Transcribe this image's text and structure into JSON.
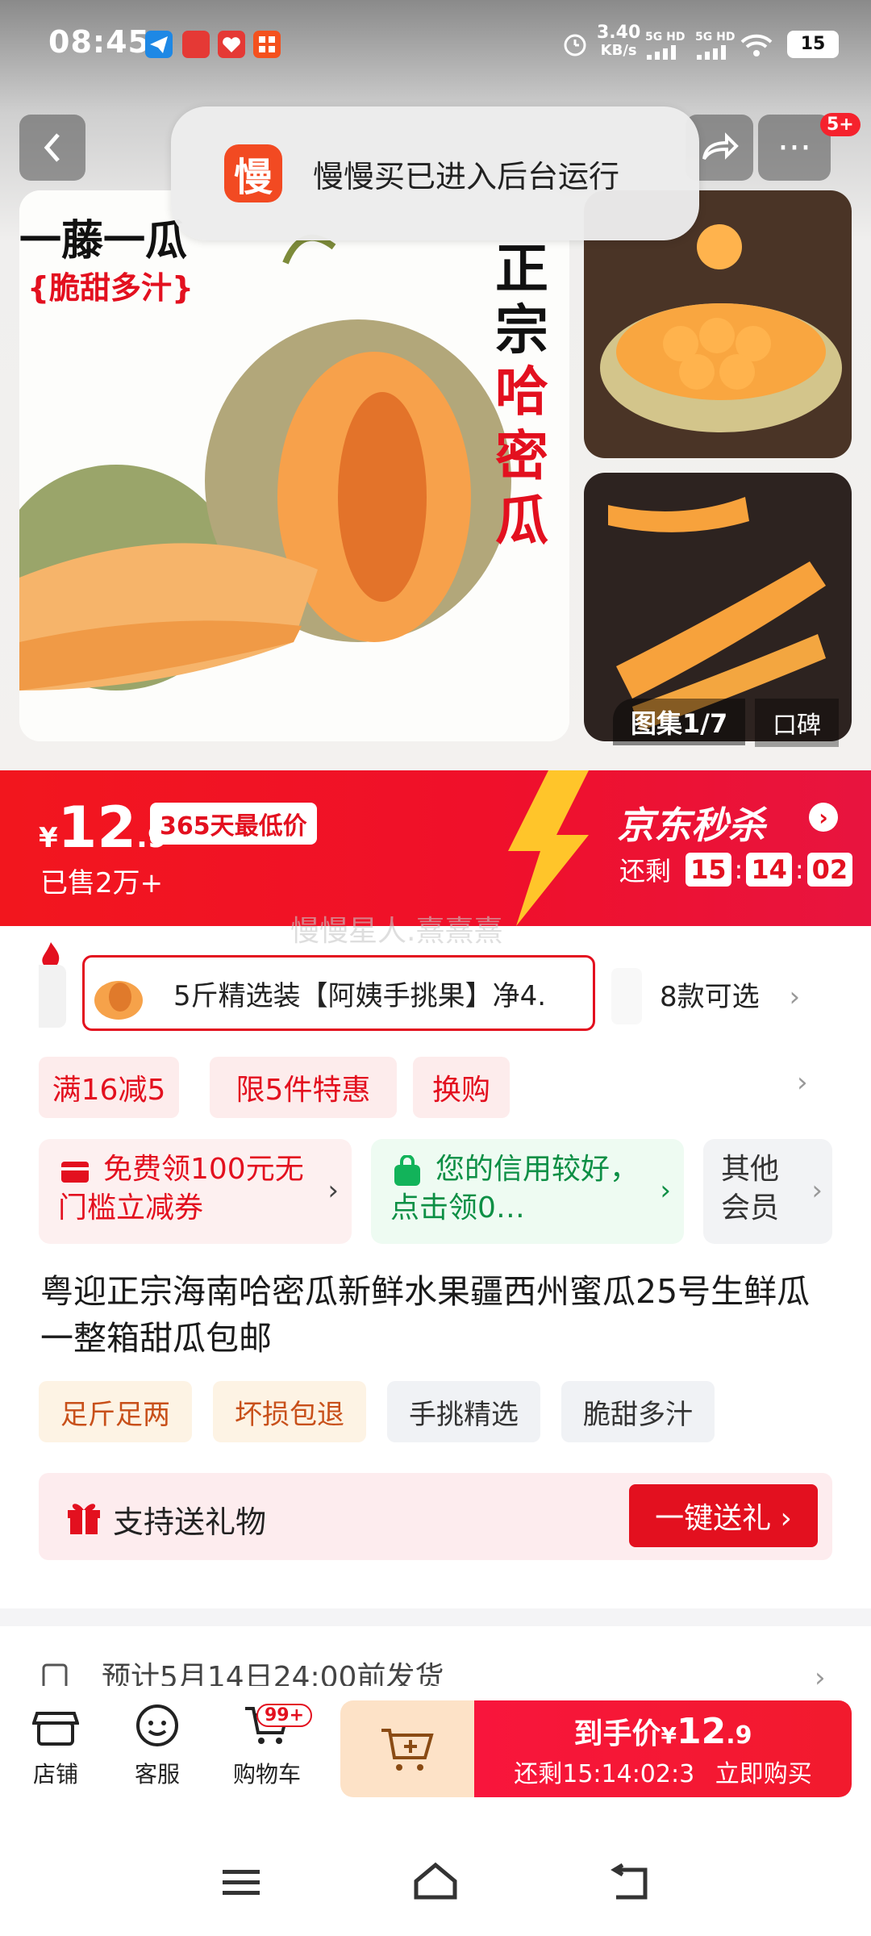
{
  "status_bar": {
    "time": "08:45",
    "net_speed_value": "3.40",
    "net_speed_unit": "KB/s",
    "sig1": "5G HD",
    "sig2": "5G HD",
    "battery": "15"
  },
  "topnav": {
    "back": "‹",
    "share": "↱",
    "more": "···",
    "more_badge": "5+"
  },
  "toast": {
    "logo_char": "慢",
    "message": "慢慢买已进入后台运行"
  },
  "hero_image": {
    "line1": "一藤一瓜",
    "line2": "{脆甜多汁}",
    "vertical_1": "正宗",
    "vertical_2": "哈密瓜"
  },
  "gallery": {
    "count": "图集1/7",
    "review": "口碑"
  },
  "price_banner": {
    "currency": "¥",
    "price_int": "12",
    "price_dec": ".9",
    "lowest_tag": "365天最低价",
    "sold": "已售2万+",
    "seckill_title": "京东秒杀",
    "countdown_label": "还剩",
    "countdown": [
      "15",
      "14",
      "02"
    ],
    "sep": ":"
  },
  "watermark": "慢慢星人.熹熹熹",
  "variants": {
    "selected_label": "5斤精选装【阿姨手挑果】净4.",
    "more_label": "8款可选"
  },
  "promotions": [
    "满16减5",
    "限5件特惠",
    "换购"
  ],
  "coupons": {
    "coupon1": "免费领100元无门槛立减券",
    "coupon2": "您的信用较好，点击领0…",
    "coupon3": "其他会员"
  },
  "product_title": "粤迎正宗海南哈密瓜新鲜水果疆西州蜜瓜25号生鲜瓜一整箱甜瓜包邮",
  "features": [
    "足斤足两",
    "坏损包退",
    "手挑精选",
    "脆甜多汁"
  ],
  "gift": {
    "label": "支持送礼物",
    "button": "一键送礼 ›"
  },
  "shipping": {
    "text": "预计5月14日24:00前发货"
  },
  "bottom_bar": {
    "shop": "店铺",
    "service": "客服",
    "cart": "购物车",
    "cart_badge": "99+",
    "buy_price_label": "到手价",
    "buy_price_cur": "¥",
    "buy_price_int": "12",
    "buy_price_dec": ".9",
    "buy_countdown": "还剩15:14:02:3",
    "buy_action": "立即购买"
  },
  "colors": {
    "accent_red": "#e3101f",
    "promo_bg": "#fdecec",
    "credit_green": "#12b35a"
  }
}
